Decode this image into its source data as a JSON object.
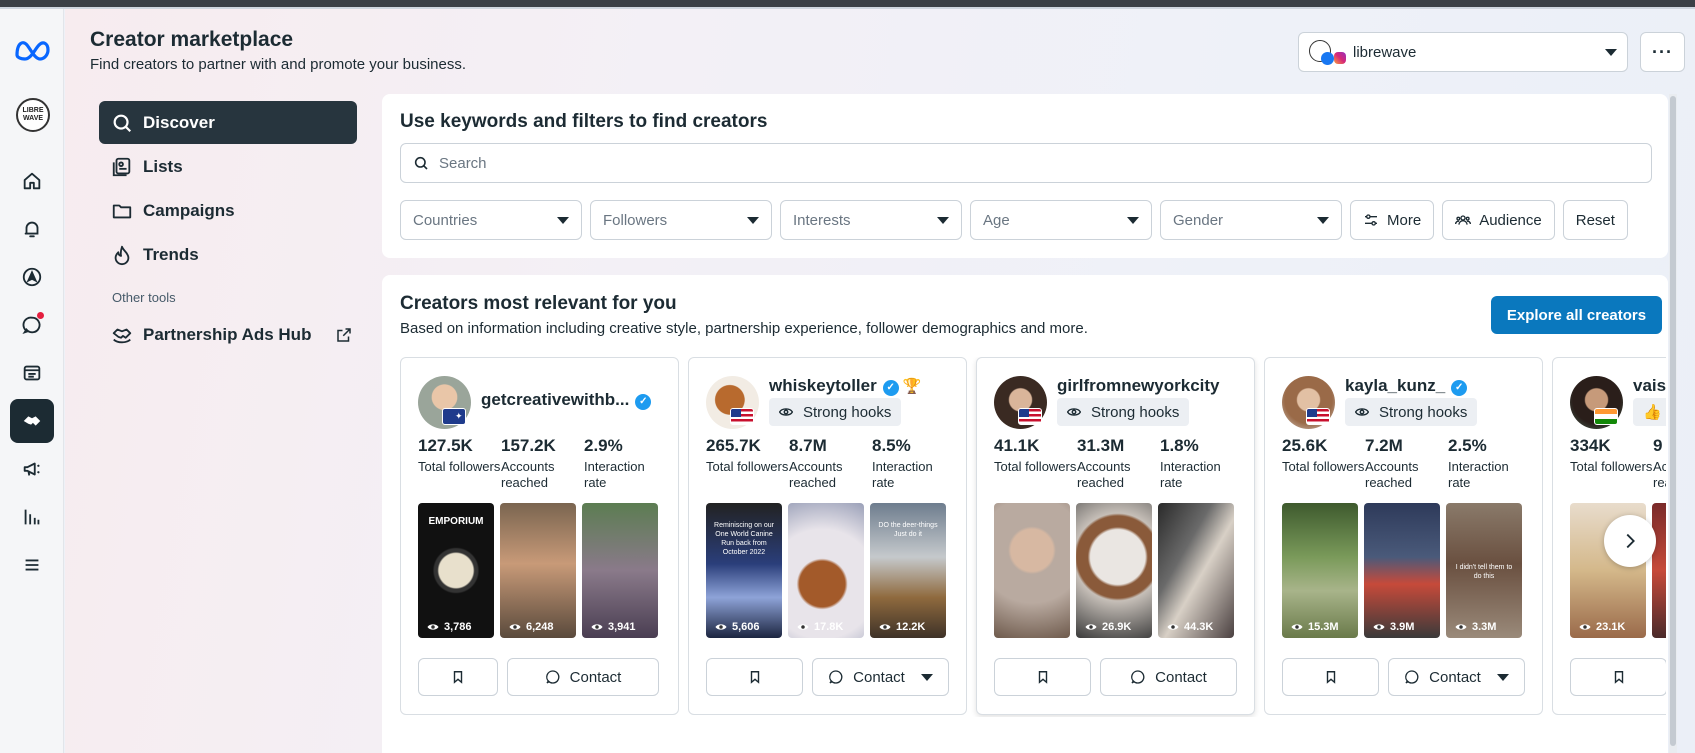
{
  "header": {
    "title": "Creator marketplace",
    "subtitle": "Find creators to partner with and promote your business.",
    "account_name": "librewave",
    "brand_logo_text": "LIBRE WAVE"
  },
  "sidenav": {
    "items": [
      {
        "label": "Discover",
        "icon": "search-icon"
      },
      {
        "label": "Lists",
        "icon": "lists-icon"
      },
      {
        "label": "Campaigns",
        "icon": "folder-icon"
      },
      {
        "label": "Trends",
        "icon": "flame-icon"
      }
    ],
    "section_label": "Other tools",
    "tools": [
      {
        "label": "Partnership Ads Hub",
        "icon": "handshake-icon"
      }
    ]
  },
  "search_panel": {
    "title": "Use keywords and filters to find creators",
    "search_placeholder": "Search",
    "filters": [
      "Countries",
      "Followers",
      "Interests",
      "Age",
      "Gender"
    ],
    "more_label": "More",
    "audience_label": "Audience",
    "reset_label": "Reset"
  },
  "creators_panel": {
    "title": "Creators most relevant for you",
    "subtitle": "Based on information including creative style, partnership experience, follower demographics and more.",
    "explore_label": "Explore all creators",
    "stat_labels": {
      "followers": "Total followers",
      "reached": "Accounts reached",
      "interaction": "Interaction rate"
    },
    "contact_label": "Contact",
    "cards": [
      {
        "username": "getcreativewithb...",
        "flag": "au",
        "badge": "",
        "followers": "127.5K",
        "reached": "157.2K",
        "interaction": "2.9%",
        "views": [
          "3,786",
          "6,248",
          "3,941"
        ],
        "thumb_texts": [
          "EMPORIUM",
          "",
          ""
        ]
      },
      {
        "username": "whiskeytoller",
        "flag": "us",
        "badge": "Strong hooks",
        "followers": "265.7K",
        "reached": "8.7M",
        "interaction": "8.5%",
        "views": [
          "5,606",
          "17.8K",
          "12.2K"
        ],
        "thumb_texts": [
          "Reminiscing on our One World Canine Run back from October 2022",
          "",
          "DO the deer-things Just do it"
        ]
      },
      {
        "username": "girlfromnewyorkcity",
        "flag": "us",
        "badge": "Strong hooks",
        "followers": "41.1K",
        "reached": "31.3M",
        "interaction": "1.8%",
        "views": [
          "",
          "26.9K",
          "44.3K"
        ],
        "thumb_texts": [
          "",
          "",
          ""
        ]
      },
      {
        "username": "kayla_kunz_",
        "flag": "us",
        "badge": "Strong hooks",
        "followers": "25.6K",
        "reached": "7.2M",
        "interaction": "2.5%",
        "views": [
          "15.3M",
          "3.9M",
          "3.3M"
        ],
        "thumb_texts": [
          "",
          "",
          "I didn't tell them to do this"
        ]
      },
      {
        "username": "vais",
        "flag": "in",
        "badge": "",
        "followers": "334K",
        "reached": "9",
        "interaction": "",
        "views": [
          "23.1K"
        ],
        "thumb_texts": [
          ""
        ]
      }
    ]
  },
  "colors": {
    "primary_button": "#0a78be",
    "nav_active": "#27353e",
    "verified": "#1d9bf0"
  }
}
